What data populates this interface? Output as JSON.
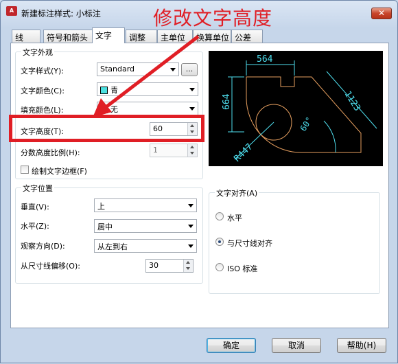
{
  "window": {
    "title": "新建标注样式: 小标注",
    "close_label": "✕",
    "annotation": "修改文字高度"
  },
  "tabs": [
    {
      "label": "线"
    },
    {
      "label": "符号和箭头"
    },
    {
      "label": "文字",
      "active": true
    },
    {
      "label": "调整"
    },
    {
      "label": "主单位"
    },
    {
      "label": "换算单位"
    },
    {
      "label": "公差"
    }
  ],
  "text_appearance": {
    "group_label": "文字外观",
    "style_label": "文字样式(Y):",
    "style_value": "Standard",
    "style_button": "...",
    "color_label": "文字颜色(C):",
    "color_value": "青",
    "color_hex": "#4ce0e0",
    "fill_label": "填充颜色(L):",
    "fill_value": "无",
    "height_label": "文字高度(T):",
    "height_value": "60",
    "fraction_label": "分数高度比例(H):",
    "fraction_value": "1",
    "frame_label": "绘制文字边框(F)",
    "frame_checked": false
  },
  "preview": {
    "dim_top": "564",
    "dim_left": "664",
    "dim_right": "1123",
    "dim_angle": "60°",
    "dim_radius": "R447",
    "dim_color": "#4fe0f0",
    "geometry_color": "#e8a060"
  },
  "text_placement": {
    "group_label": "文字位置",
    "vertical_label": "垂直(V):",
    "vertical_value": "上",
    "horizontal_label": "水平(Z):",
    "horizontal_value": "居中",
    "view_label": "观察方向(D):",
    "view_value": "从左到右",
    "offset_label": "从尺寸线偏移(O):",
    "offset_value": "30"
  },
  "text_alignment": {
    "group_label": "文字对齐(A)",
    "options": [
      {
        "label": "水平",
        "checked": false
      },
      {
        "label": "与尺寸线对齐",
        "checked": true
      },
      {
        "label": "ISO 标准",
        "checked": false
      }
    ]
  },
  "buttons": {
    "ok": "确定",
    "cancel": "取消",
    "help": "帮助(H)"
  },
  "colors": {
    "annotation_red": "#e01e25"
  }
}
